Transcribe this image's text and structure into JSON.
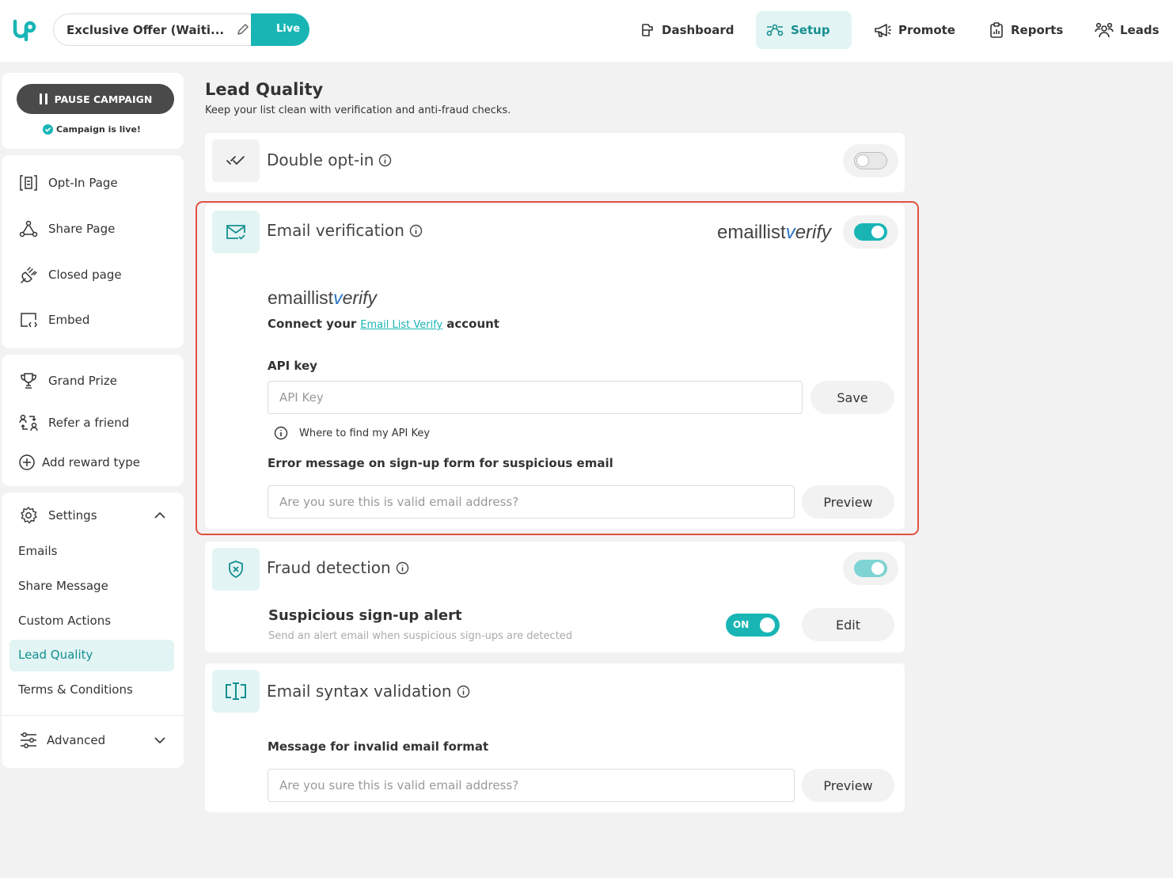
{
  "topbar": {
    "campaign_name": "Exclusive Offer (Waiti...",
    "live_label": "Live",
    "nav": [
      {
        "label": "Dashboard",
        "icon": "dashboard-icon",
        "active": false
      },
      {
        "label": "Setup",
        "icon": "setup-icon",
        "active": true
      },
      {
        "label": "Promote",
        "icon": "megaphone-icon",
        "active": false
      },
      {
        "label": "Reports",
        "icon": "clipboard-chart-icon",
        "active": false
      },
      {
        "label": "Leads",
        "icon": "people-icon",
        "active": false
      }
    ]
  },
  "sidebar": {
    "pause_label": "PAUSE CAMPAIGN",
    "live_status": "Campaign is live!",
    "pages": [
      {
        "label": "Opt-In Page",
        "icon": "opt-in-page-icon"
      },
      {
        "label": "Share Page",
        "icon": "share-page-icon"
      },
      {
        "label": "Closed page",
        "icon": "plug-icon"
      },
      {
        "label": "Embed",
        "icon": "embed-icon"
      }
    ],
    "rewards": [
      {
        "label": "Grand Prize",
        "icon": "trophy-icon"
      },
      {
        "label": "Refer a friend",
        "icon": "refer-friend-icon"
      },
      {
        "label": "Add reward type",
        "icon": "plus-circle-icon"
      }
    ],
    "settings": {
      "label": "Settings",
      "items": [
        "Emails",
        "Share Message",
        "Custom Actions",
        "Lead Quality",
        "Terms & Conditions"
      ],
      "active": "Lead Quality"
    },
    "advanced_label": "Advanced"
  },
  "main": {
    "title": "Lead Quality",
    "subtitle": "Keep your list clean with verification and anti-fraud checks.",
    "double_optin": {
      "title": "Double opt-in",
      "enabled": false
    },
    "email_verification": {
      "title": "Email verification",
      "enabled": true,
      "brand_prefix": "emaillist",
      "brand_v": "v",
      "brand_suffix": "erify",
      "connect_prefix": "Connect your",
      "connect_link": "Email List Verify",
      "connect_suffix": "account",
      "api_key_label": "API key",
      "api_key_placeholder": "API Key",
      "save_label": "Save",
      "help_text": "Where to find my API Key",
      "error_label": "Error message on sign-up form for suspicious email",
      "error_placeholder": "Are you sure this is valid email address?",
      "preview_label": "Preview"
    },
    "fraud_detection": {
      "title": "Fraud detection",
      "enabled": true,
      "alert_title": "Suspicious sign-up alert",
      "alert_desc": "Send an alert email when suspicious sign-ups are detected",
      "alert_toggle_label": "ON",
      "edit_label": "Edit"
    },
    "syntax_validation": {
      "title": "Email syntax validation",
      "message_label": "Message for invalid email format",
      "message_placeholder": "Are you sure this is valid email address?",
      "preview_label": "Preview"
    }
  },
  "colors": {
    "accent": "#19b5b5",
    "highlight_border": "#e0523f",
    "dark_button": "#4a4a4a"
  }
}
